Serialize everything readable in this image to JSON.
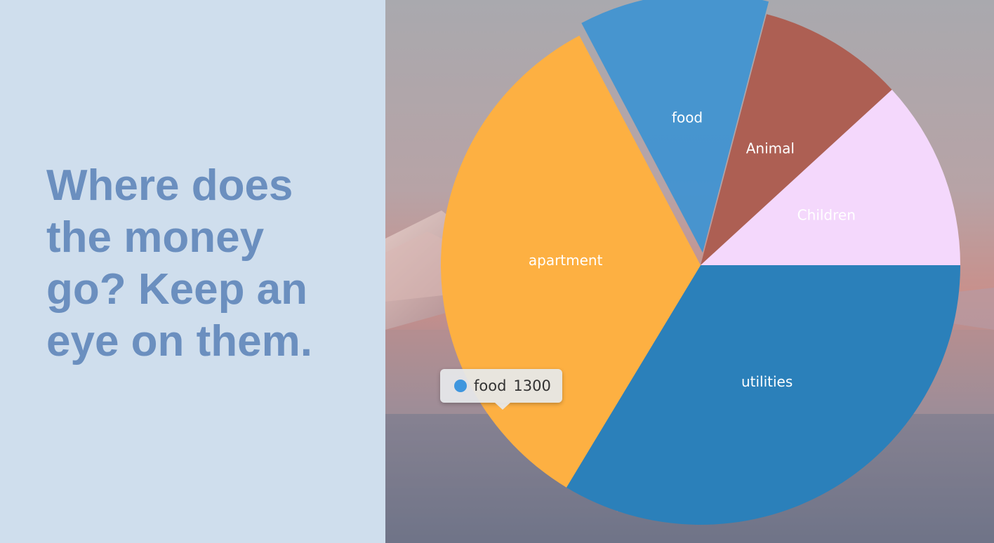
{
  "headline": "Where does the money go? Keep an eye on them.",
  "chart_data": {
    "type": "pie",
    "title": "",
    "slices": [
      {
        "label": "utilities",
        "value": 3700,
        "color": "#2b80ba"
      },
      {
        "label": "apartment",
        "value": 3700,
        "color": "#fdb042"
      },
      {
        "label": "food",
        "value": 1300,
        "color": "#4193d1",
        "highlighted": true
      },
      {
        "label": "Animal",
        "value": 1000,
        "color": "#ad5f53"
      },
      {
        "label": "Children",
        "value": 1300,
        "color": "#f4d8fc"
      }
    ]
  },
  "tooltip": {
    "label": "food",
    "value": "1300",
    "color": "#3f96de"
  }
}
